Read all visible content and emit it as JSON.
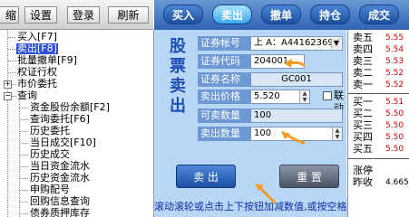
{
  "toolbar": {
    "buttons": [
      {
        "label": "缩屏"
      },
      {
        "label": "设置"
      },
      {
        "label": "登录"
      },
      {
        "label": "刷新"
      }
    ]
  },
  "tree": {
    "items": [
      {
        "label": "买入[F7]"
      },
      {
        "label": "卖出[F8]",
        "selected": true
      },
      {
        "label": "批量撤单[F9]"
      },
      {
        "label": "权证行权"
      },
      {
        "label": "市价委托"
      },
      {
        "label": "查询"
      },
      {
        "label": "资金股份余额[F2]"
      },
      {
        "label": "查询委托[F6]"
      },
      {
        "label": "历史委托"
      },
      {
        "label": "当日成交[F10]"
      },
      {
        "label": "历史成交"
      },
      {
        "label": "当日资金流水"
      },
      {
        "label": "历史资金流水"
      },
      {
        "label": "申购配号"
      },
      {
        "label": "回购信息查询"
      },
      {
        "label": "债券质押库存"
      }
    ]
  },
  "tabs": [
    {
      "label": "买入"
    },
    {
      "label": "卖出",
      "active": true
    },
    {
      "label": "撤单"
    },
    {
      "label": "持仓"
    },
    {
      "label": "成交"
    }
  ],
  "form": {
    "side_title": "股票卖出",
    "account_label": "证券帐号",
    "account_value": "上 A：A441623696",
    "code_label": "证券代码",
    "code_value": "204001",
    "name_label": "证券名称",
    "name_value": "GC001",
    "price_label": "卖出价格",
    "price_value": "5.520",
    "linkage_label": "联动",
    "available_label": "可卖数量",
    "available_value": "100",
    "qty_label": "卖出数量",
    "qty_value": "100",
    "sell_button": "卖 出",
    "reset_button": "重 置",
    "tip": "滚动滚轮或点击上下按钮加减数值,或按空格选择仓位"
  },
  "quote": {
    "asks": [
      {
        "label": "卖五",
        "value": "5.55"
      },
      {
        "label": "卖四",
        "value": "5.54"
      },
      {
        "label": "卖三",
        "value": "5.53"
      },
      {
        "label": "卖二",
        "value": "5.52"
      },
      {
        "label": "卖一",
        "value": "5.52"
      }
    ],
    "bids": [
      {
        "label": "买一",
        "value": "5.51"
      },
      {
        "label": "买二",
        "value": "5.50"
      },
      {
        "label": "买三",
        "value": "5.50"
      },
      {
        "label": "买四",
        "value": "5.50"
      },
      {
        "label": "买五",
        "value": "5.50"
      }
    ],
    "change_label": "涨停",
    "change_value": "",
    "prev_close_label": "昨收",
    "prev_close_value": "4.665"
  },
  "colors": {
    "selected": "#2f52d8",
    "panel": "#b8d6f5",
    "quote_value": "#d40000",
    "highlight_arrow": "#f59a23"
  }
}
